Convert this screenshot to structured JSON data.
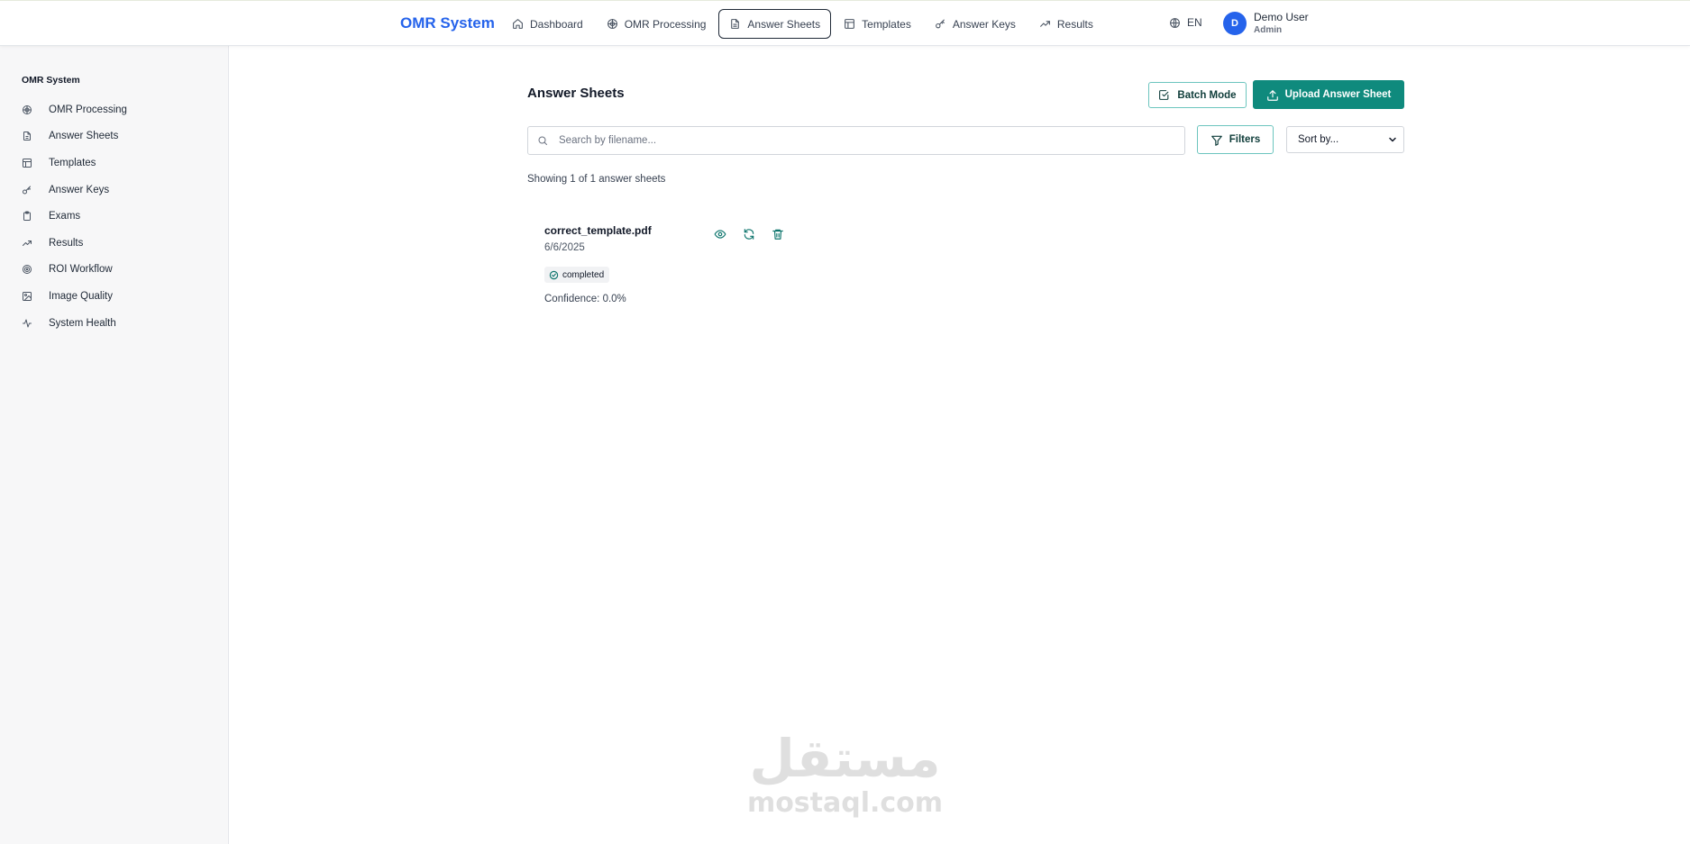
{
  "app": {
    "brand": "OMR System"
  },
  "nav": {
    "items": [
      {
        "label": "Dashboard",
        "icon": "home-icon"
      },
      {
        "label": "OMR Processing",
        "icon": "scan-icon"
      },
      {
        "label": "Answer Sheets",
        "icon": "file-icon",
        "active": true
      },
      {
        "label": "Templates",
        "icon": "layout-icon"
      },
      {
        "label": "Answer Keys",
        "icon": "key-icon"
      },
      {
        "label": "Results",
        "icon": "trending-up-icon"
      }
    ],
    "language": "EN"
  },
  "user": {
    "initial": "D",
    "name": "Demo User",
    "role": "Admin"
  },
  "sidebar": {
    "title": "OMR System",
    "items": [
      {
        "label": "OMR Processing",
        "icon": "scan-icon"
      },
      {
        "label": "Answer Sheets",
        "icon": "file-icon"
      },
      {
        "label": "Templates",
        "icon": "layout-icon"
      },
      {
        "label": "Answer Keys",
        "icon": "key-icon"
      },
      {
        "label": "Exams",
        "icon": "clipboard-icon"
      },
      {
        "label": "Results",
        "icon": "trending-up-icon"
      },
      {
        "label": "ROI Workflow",
        "icon": "target-icon"
      },
      {
        "label": "Image Quality",
        "icon": "image-icon"
      },
      {
        "label": "System Health",
        "icon": "activity-icon"
      }
    ]
  },
  "main": {
    "title": "Answer Sheets",
    "batch_button": "Batch Mode",
    "upload_button": "Upload Answer Sheet",
    "search_placeholder": "Search by filename...",
    "filters_button": "Filters",
    "sort_value": "Sort by...",
    "count_text": "Showing 1 of 1 answer sheets",
    "sheets": [
      {
        "filename": "correct_template.pdf",
        "date": "6/6/2025",
        "status": "completed",
        "confidence": "Confidence: 0.0%"
      }
    ]
  },
  "watermark": {
    "arabic": "مستقل",
    "latin": "mostaql.com"
  },
  "colors": {
    "brand": "#2563eb",
    "accent": "#0f8a7d",
    "accent_border": "#6cc5be"
  }
}
